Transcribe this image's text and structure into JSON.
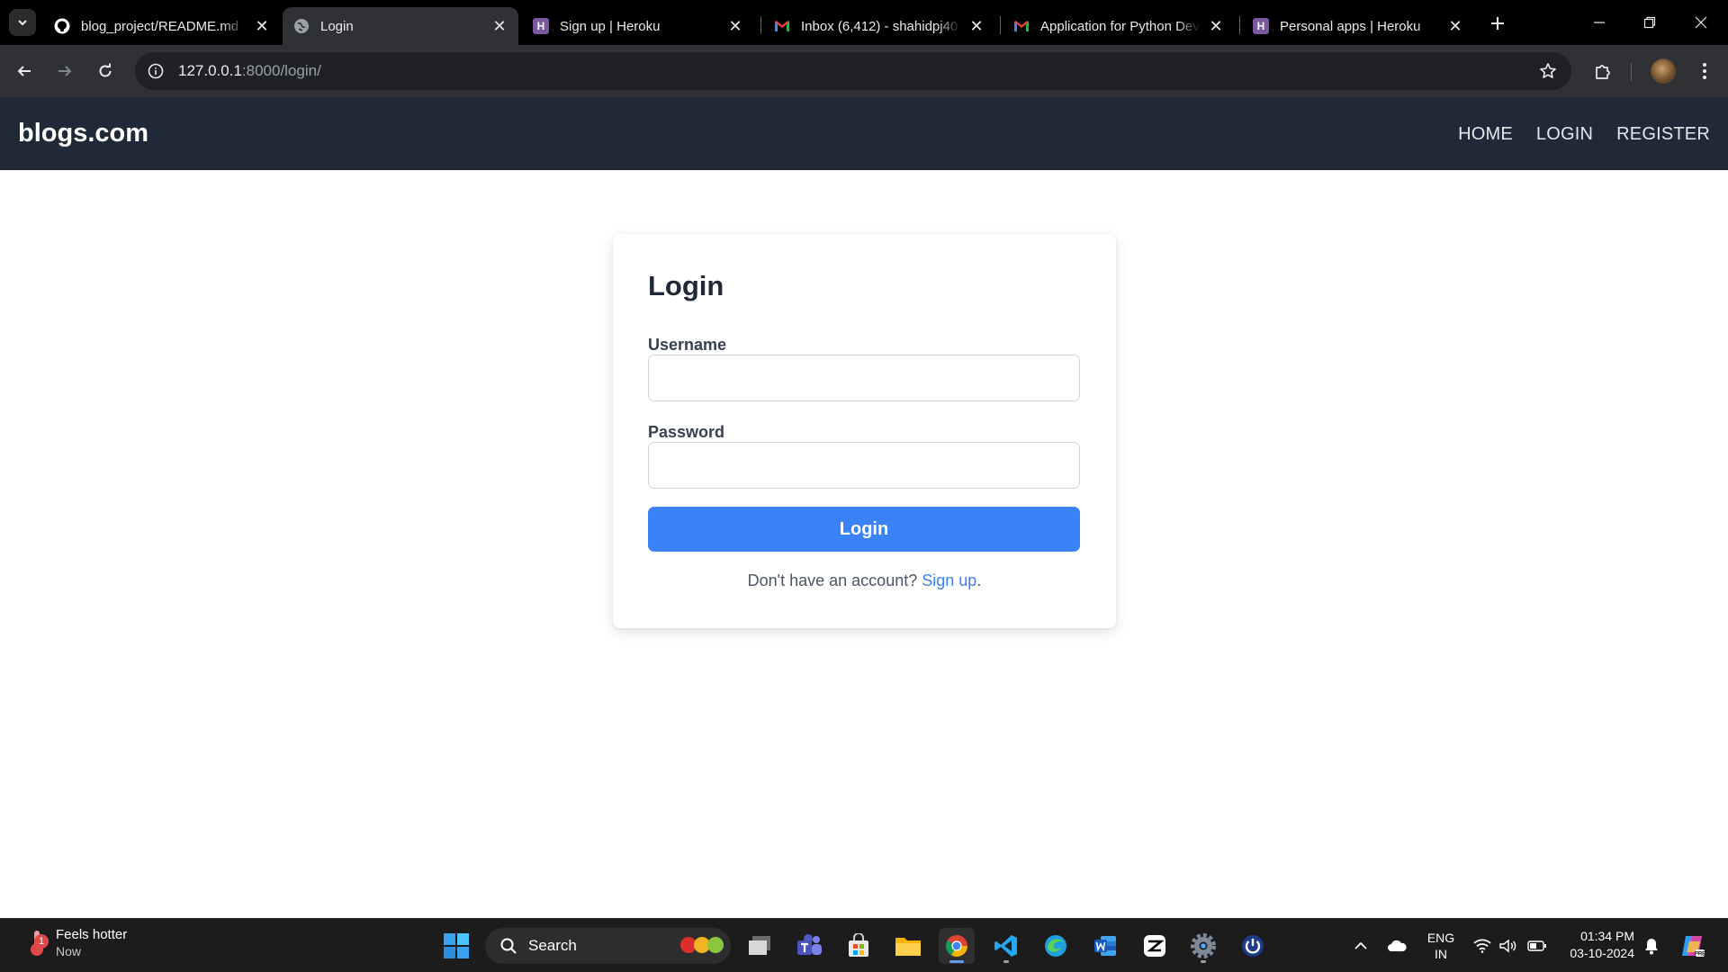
{
  "browser": {
    "tabs": [
      {
        "title": "blog_project/README.md",
        "icon": "github-icon",
        "active": false
      },
      {
        "title": "Login",
        "icon": "globe-icon",
        "active": true
      },
      {
        "title": "Sign up | Heroku",
        "icon": "heroku-icon",
        "active": false
      },
      {
        "title": "Inbox (6,412) - shahidpj40…",
        "icon": "gmail-icon",
        "active": false
      },
      {
        "title": "Application for Python Dev",
        "icon": "gmail-icon",
        "active": false
      },
      {
        "title": "Personal apps | Heroku",
        "icon": "heroku-icon",
        "active": false
      }
    ],
    "url_host": "127.0.0.1",
    "url_rest": ":8000/login/"
  },
  "site": {
    "brand": "blogs.com",
    "nav": [
      "HOME",
      "LOGIN",
      "REGISTER"
    ]
  },
  "login": {
    "title": "Login",
    "username_label": "Username",
    "username_value": "",
    "password_label": "Password",
    "password_value": "",
    "submit_label": "Login",
    "signup_prompt": "Don't have an account?",
    "signup_link": "Sign up",
    "signup_suffix": "."
  },
  "taskbar": {
    "weather_title": "Feels hotter",
    "weather_sub": "Now",
    "weather_badge": "1",
    "search_label": "Search",
    "language_top": "ENG",
    "language_bottom": "IN",
    "time": "01:34 PM",
    "date": "03-10-2024",
    "apps": [
      "start-icon",
      "task-view-icon",
      "teams-icon",
      "store-icon",
      "file-explorer-icon",
      "chrome-icon",
      "vscode-icon",
      "edge-icon",
      "word-icon",
      "capcut-icon",
      "settings-icon",
      "power-icon"
    ]
  },
  "colors": {
    "nav_bg": "#1f2937",
    "accent": "#3b82f6",
    "browser_bg": "#303134",
    "taskbar_bg": "#1c1c1c"
  }
}
